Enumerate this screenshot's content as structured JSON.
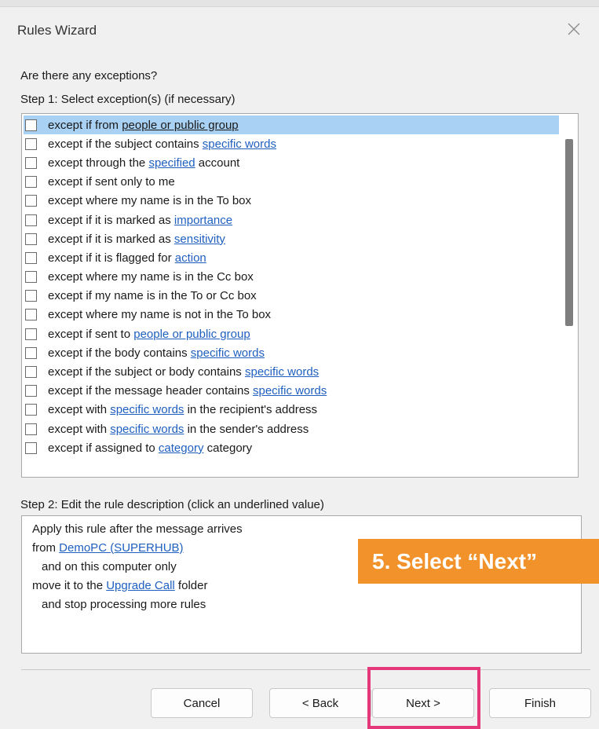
{
  "window": {
    "title": "Rules Wizard"
  },
  "prompt": "Are there any exceptions?",
  "step1_label": "Step 1: Select exception(s) (if necessary)",
  "exceptions": [
    {
      "pre": "except if from ",
      "link": "people or public group",
      "post": "",
      "selected": true
    },
    {
      "pre": "except if the subject contains ",
      "link": "specific words",
      "post": ""
    },
    {
      "pre": "except through the ",
      "link": "specified",
      "post": " account"
    },
    {
      "pre": "except if sent only to me",
      "link": "",
      "post": ""
    },
    {
      "pre": "except where my name is in the To box",
      "link": "",
      "post": ""
    },
    {
      "pre": "except if it is marked as ",
      "link": "importance",
      "post": ""
    },
    {
      "pre": "except if it is marked as ",
      "link": "sensitivity",
      "post": ""
    },
    {
      "pre": "except if it is flagged for ",
      "link": "action",
      "post": ""
    },
    {
      "pre": "except where my name is in the Cc box",
      "link": "",
      "post": ""
    },
    {
      "pre": "except if my name is in the To or Cc box",
      "link": "",
      "post": ""
    },
    {
      "pre": "except where my name is not in the To box",
      "link": "",
      "post": ""
    },
    {
      "pre": "except if sent to ",
      "link": "people or public group",
      "post": ""
    },
    {
      "pre": "except if the body contains ",
      "link": "specific words",
      "post": ""
    },
    {
      "pre": "except if the subject or body contains ",
      "link": "specific words",
      "post": ""
    },
    {
      "pre": "except if the message header contains ",
      "link": "specific words",
      "post": ""
    },
    {
      "pre": "except with ",
      "link": "specific words",
      "post": " in the recipient's address"
    },
    {
      "pre": "except with ",
      "link": "specific words",
      "post": " in the sender's address"
    },
    {
      "pre": "except if assigned to ",
      "link": "category",
      "post": " category"
    }
  ],
  "step2_label": "Step 2: Edit the rule description (click an underlined value)",
  "description": {
    "line1": "Apply this rule after the message arrives",
    "line2_pre": "from ",
    "line2_link": "DemoPC (SUPERHUB)",
    "line3": "and on this computer only",
    "line4_pre": "move it to the ",
    "line4_link": "Upgrade Call",
    "line4_post": " folder",
    "line5": "and stop processing more rules"
  },
  "callout": "5. Select “Next”",
  "buttons": {
    "cancel": "Cancel",
    "back": "< Back",
    "next": "Next >",
    "finish": "Finish"
  },
  "colors": {
    "link": "#1f5fbf",
    "selection": "#a9d1f3",
    "callout": "#f2922b",
    "highlight": "#e4387a"
  },
  "icons": {
    "close": "close-icon"
  }
}
